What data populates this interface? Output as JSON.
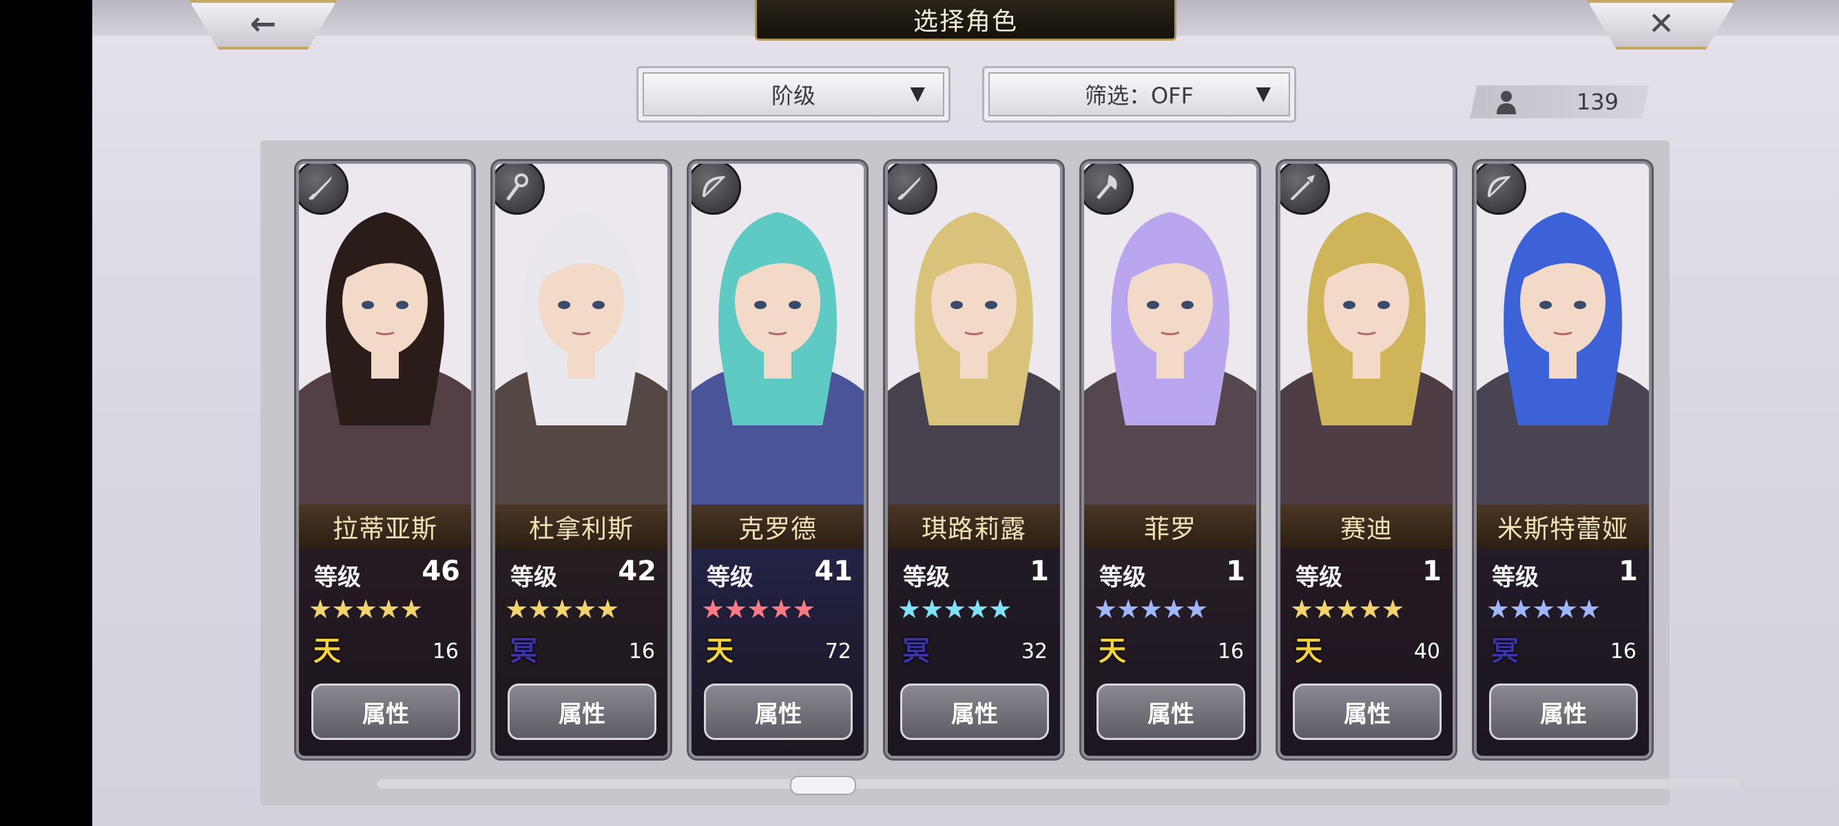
{
  "header": {
    "title": "选择角色",
    "back_icon": "←",
    "close_icon": "✕"
  },
  "filters": {
    "rank_label": "阶级",
    "filter_label": "筛选：OFF",
    "dropdown_arrow": "▼"
  },
  "owned_count": "139",
  "level_label": "等级",
  "attr_label": "属性",
  "characters": [
    {
      "name": "拉蒂亚斯",
      "level": "46",
      "stars": "★★★★★",
      "star_color": "#f2d36c",
      "element": "天",
      "element_color": "#f3d23c",
      "cost": "16",
      "weapon": "sword-icon",
      "card_bg": "#3a2226"
    },
    {
      "name": "杜拿利斯",
      "level": "42",
      "stars": "★★★★★",
      "star_color": "#f2d36c",
      "element": "冥",
      "element_color": "#3d33a8",
      "cost": "16",
      "weapon": "staff-icon",
      "card_bg": "#3a2a26"
    },
    {
      "name": "克罗德",
      "level": "41",
      "stars": "★★★★★",
      "star_color": "#ff7a86",
      "element": "天",
      "element_color": "#f3d23c",
      "cost": "72",
      "weapon": "bow-icon",
      "card_bg": "#2d3a8a"
    },
    {
      "name": "琪路莉露",
      "level": "1",
      "stars": "★★★★★",
      "star_color": "#7ee3f5",
      "element": "冥",
      "element_color": "#3d33a8",
      "cost": "32",
      "weapon": "sword-icon",
      "card_bg": "#2a2230"
    },
    {
      "name": "菲罗",
      "level": "1",
      "stars": "★★★★★",
      "star_color": "#9fb7ff",
      "element": "天",
      "element_color": "#f3d23c",
      "cost": "16",
      "weapon": "axe-icon",
      "card_bg": "#3a2a32"
    },
    {
      "name": "赛迪",
      "level": "1",
      "stars": "★★★★★",
      "star_color": "#f2d36c",
      "element": "天",
      "element_color": "#f3d23c",
      "cost": "40",
      "weapon": "spear-icon",
      "card_bg": "#341e28"
    },
    {
      "name": "米斯特蕾娅",
      "level": "1",
      "stars": "★★★★★",
      "star_color": "#9fb7ff",
      "element": "冥",
      "element_color": "#3d33a8",
      "cost": "16",
      "weapon": "bow-icon",
      "card_bg": "#2e2636"
    }
  ]
}
